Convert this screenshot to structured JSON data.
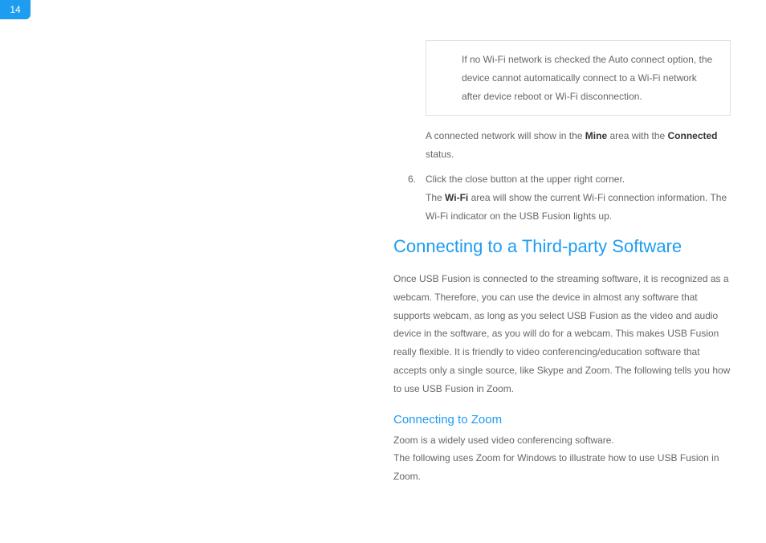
{
  "page_number": "14",
  "note_box": "If no Wi-Fi network is checked the Auto connect option, the device cannot automatically connect to a Wi-Fi network after device reboot or Wi-Fi disconnection.",
  "post_note_pre": "A connected network will show in the ",
  "post_note_bold1": "Mine",
  "post_note_mid": " area with the ",
  "post_note_bold2": "Connected",
  "post_note_end": " status.",
  "step6_num": "6.",
  "step6_line1": "Click the close button at the upper right corner.",
  "step6_line2_pre": "The ",
  "step6_line2_bold": "Wi-Fi",
  "step6_line2_post": " area will show the current Wi-Fi connection information. The Wi-Fi indicator on the USB Fusion lights up.",
  "section_title": "Connecting to a Third-party Software",
  "section_paragraph": "Once USB Fusion is connected to the streaming software, it is recognized as a webcam. Therefore, you can use the device in almost any software that supports webcam, as long as you select USB Fusion as the video and audio device in the software, as you will do for a webcam. This makes USB Fusion really flexible. It is friendly to video conferencing/education software that accepts only a single source, like Skype and Zoom. The following tells you how to use USB Fusion in Zoom.",
  "subsection_title": "Connecting to Zoom",
  "sub_line1": "Zoom is a widely used video conferencing software.",
  "sub_line2": "The following uses Zoom for Windows to illustrate how to use USB Fusion in Zoom."
}
